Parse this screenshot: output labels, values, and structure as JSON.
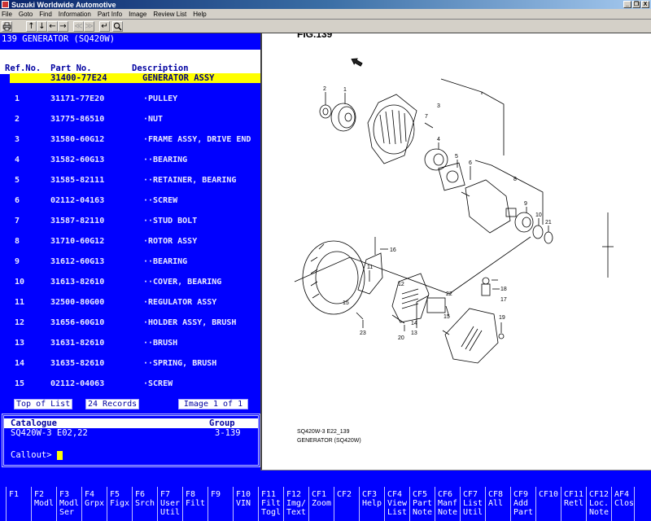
{
  "window": {
    "title": "Suzuki Worldwide Automotive",
    "buttons": [
      "_",
      "❐",
      "X"
    ]
  },
  "menu": [
    "File",
    "Goto",
    "Find",
    "Information",
    "Part Info",
    "Image",
    "Review List",
    "Help"
  ],
  "toolbar": {
    "print": "print-icon",
    "up": "↑",
    "down": "↓",
    "left": "←",
    "right": "→",
    "prev": "≪",
    "next": "≫",
    "enter": "↵",
    "search": "⌕"
  },
  "parts_list": {
    "group_title": "139 GENERATOR (SQ420W)",
    "columns": {
      "ref": "Ref.No.",
      "part": "Part No.",
      "desc": "Description"
    },
    "selected": {
      "ref": "",
      "part": "31400-77E24",
      "desc": "GENERATOR ASSY"
    },
    "rows": [
      {
        "ref": "1",
        "part": "31171-77E20",
        "desc": "·PULLEY"
      },
      {
        "ref": "2",
        "part": "31775-86510",
        "desc": "·NUT"
      },
      {
        "ref": "3",
        "part": "31580-60G12",
        "desc": "·FRAME ASSY, DRIVE END"
      },
      {
        "ref": "4",
        "part": "31582-60G13",
        "desc": "··BEARING"
      },
      {
        "ref": "5",
        "part": "31585-82111",
        "desc": "··RETAINER, BEARING"
      },
      {
        "ref": "6",
        "part": "02112-04163",
        "desc": "··SCREW"
      },
      {
        "ref": "7",
        "part": "31587-82110",
        "desc": "··STUD BOLT"
      },
      {
        "ref": "8",
        "part": "31710-60G12",
        "desc": "·ROTOR ASSY"
      },
      {
        "ref": "9",
        "part": "31612-60G13",
        "desc": "··BEARING"
      },
      {
        "ref": "10",
        "part": "31613-82610",
        "desc": "··COVER, BEARING"
      },
      {
        "ref": "11",
        "part": "32500-80G00",
        "desc": "·REGULATOR ASSY"
      },
      {
        "ref": "12",
        "part": "31656-60G10",
        "desc": "·HOLDER ASSY, BRUSH"
      },
      {
        "ref": "13",
        "part": "31631-82610",
        "desc": "··BRUSH"
      },
      {
        "ref": "14",
        "part": "31635-82610",
        "desc": "··SPRING, BRUSH"
      },
      {
        "ref": "15",
        "part": "02112-04063",
        "desc": "·SCREW"
      }
    ],
    "status": {
      "top": "Top of List",
      "records": "24 Records",
      "image": "Image 1 of 1"
    }
  },
  "catalogue": {
    "label": "Catalogue",
    "group_label": "Group",
    "value": "SQ420W-3 E02,22",
    "group_value": "3-139",
    "prompt": "Callout>",
    "input_value": ""
  },
  "diagram": {
    "fig_title": "FIG.139",
    "caption_line1": "SQ420W-3 E22_139",
    "caption_line2": "GENERATOR (SQ420W)",
    "callouts": [
      "1",
      "2",
      "3",
      "4",
      "5",
      "6",
      "7",
      "8",
      "9",
      "10",
      "11",
      "12",
      "13",
      "14",
      "15",
      "15",
      "16",
      "17",
      "18",
      "19",
      "20",
      "21",
      "22",
      "23"
    ]
  },
  "fkeys": [
    {
      "key": "F1",
      "label": ""
    },
    {
      "key": "F2",
      "label": "Modl"
    },
    {
      "key": "F3",
      "label": "Modl\nSer"
    },
    {
      "key": "F4",
      "label": "Grpx"
    },
    {
      "key": "F5",
      "label": "Figx"
    },
    {
      "key": "F6",
      "label": "Srch"
    },
    {
      "key": "F7",
      "label": "User\nUtil"
    },
    {
      "key": "F8",
      "label": "Filt"
    },
    {
      "key": "F9",
      "label": ""
    },
    {
      "key": "F10",
      "label": "VIN"
    },
    {
      "key": "F11",
      "label": "Filt\nTogl"
    },
    {
      "key": "F12",
      "label": "Img/\nText"
    },
    {
      "key": "CF1",
      "label": "Zoom"
    },
    {
      "key": "CF2",
      "label": ""
    },
    {
      "key": "CF3",
      "label": "Help"
    },
    {
      "key": "CF4",
      "label": "View\nList"
    },
    {
      "key": "CF5",
      "label": "Part\nNote"
    },
    {
      "key": "CF6",
      "label": "Manf\nNote"
    },
    {
      "key": "CF7",
      "label": "List\nUtil"
    },
    {
      "key": "CF8",
      "label": "All"
    },
    {
      "key": "CF9",
      "label": "Add\nPart"
    },
    {
      "key": "CF10",
      "label": ""
    },
    {
      "key": "CF11",
      "label": "Retl"
    },
    {
      "key": "CF12",
      "label": "Loc.\nNote"
    },
    {
      "key": "AF4",
      "label": "Clos"
    }
  ]
}
